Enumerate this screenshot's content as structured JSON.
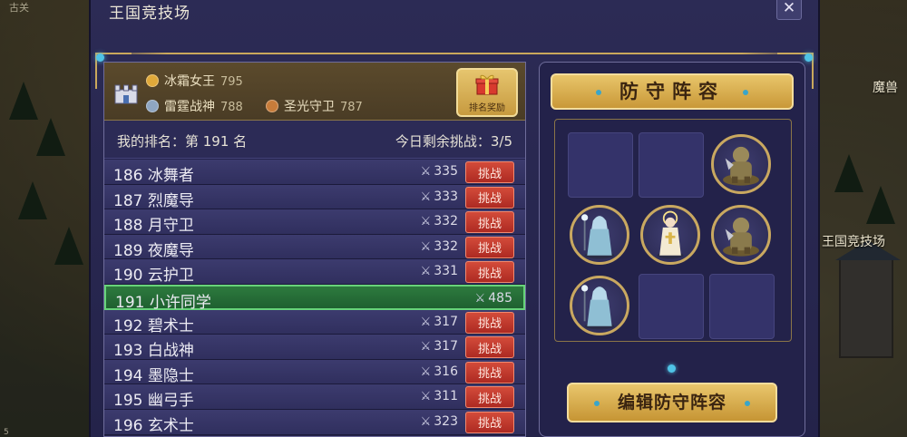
{
  "background": {
    "label_right_top": "魔兽",
    "label_arena": "王国竞技场",
    "hud_text": "古关",
    "bottom_left_text": "5"
  },
  "dialog": {
    "title": "王国竞技场",
    "close_label": "✕"
  },
  "podium": {
    "first": {
      "name": "冰霜女王",
      "power": "795",
      "medal": "gold"
    },
    "second": {
      "name": "雷霆战神",
      "power": "788",
      "medal": "silver"
    },
    "third": {
      "name": "圣光守卫",
      "power": "787",
      "medal": "bronze"
    },
    "reward_label": "排名奖励"
  },
  "rank_info": {
    "my_rank": "我的排名：第 191 名",
    "remaining": "今日剩余挑战：3/5"
  },
  "rank_list": [
    {
      "rank": "186",
      "name": "冰舞者",
      "power": "335",
      "challenge": "挑战",
      "me": false
    },
    {
      "rank": "187",
      "name": "烈魔导",
      "power": "333",
      "challenge": "挑战",
      "me": false
    },
    {
      "rank": "188",
      "name": "月守卫",
      "power": "332",
      "challenge": "挑战",
      "me": false
    },
    {
      "rank": "189",
      "name": "夜魔导",
      "power": "332",
      "challenge": "挑战",
      "me": false
    },
    {
      "rank": "190",
      "name": "云护卫",
      "power": "331",
      "challenge": "挑战",
      "me": false
    },
    {
      "rank": "191",
      "name": "小许同学",
      "power": "485",
      "challenge": "",
      "me": true
    },
    {
      "rank": "192",
      "name": "碧术士",
      "power": "317",
      "challenge": "挑战",
      "me": false
    },
    {
      "rank": "193",
      "name": "白战神",
      "power": "317",
      "challenge": "挑战",
      "me": false
    },
    {
      "rank": "194",
      "name": "墨隐士",
      "power": "316",
      "challenge": "挑战",
      "me": false
    },
    {
      "rank": "195",
      "name": "幽弓手",
      "power": "311",
      "challenge": "挑战",
      "me": false
    },
    {
      "rank": "196",
      "name": "玄术士",
      "power": "323",
      "challenge": "挑战",
      "me": false
    }
  ],
  "defense": {
    "title": "防守阵容",
    "edit_label": "编辑防守阵容",
    "slots": [
      "empty",
      "empty",
      "orc",
      "mage",
      "priest",
      "orc",
      "mage",
      "empty",
      "empty"
    ]
  },
  "colors": {
    "panel_bg": "#23224a",
    "gold": "#caa85c",
    "challenge_red": "#c23a2e",
    "me_green": "#2d7a3e"
  }
}
